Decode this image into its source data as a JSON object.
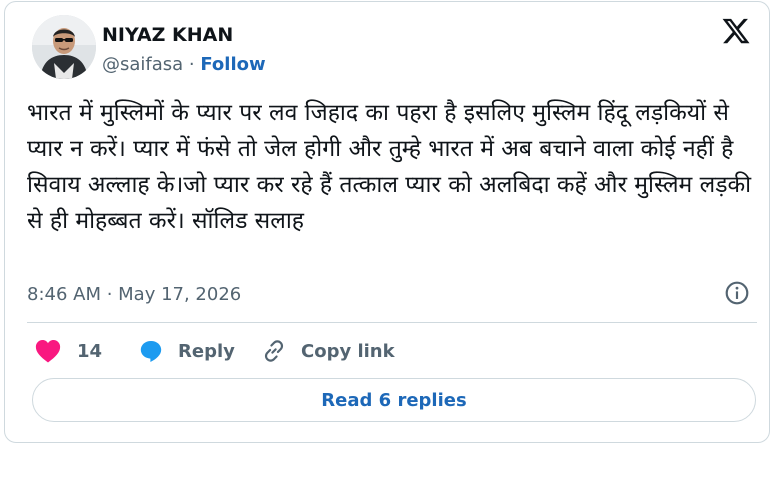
{
  "author": {
    "name": "NIYAZ KHAN",
    "handle": "@saifasa",
    "separator": " · ",
    "follow_label": "Follow"
  },
  "tweet": {
    "text": "भारत में मुस्लिमों के प्यार पर लव जिहाद का पहरा है इसलिए मुस्लिम हिंदू लड़कियों से प्यार न करें। प्यार में फंसे तो जेल होगी और तुम्हे भारत में अब बचाने वाला कोई नहीं है सिवाय अल्लाह के।जो प्यार कर रहे हैं तत्काल प्यार को अलबिदा कहें और मुस्लिम लड़की से ही मोहब्बत करें। सॉलिड सलाह",
    "timestamp": "8:46 AM · May 17, 2026"
  },
  "actions": {
    "like_count": "14",
    "reply_label": "Reply",
    "copy_link_label": "Copy link"
  },
  "read_replies_label": "Read 6 replies",
  "icons": {
    "logo": "x-logo-icon",
    "info": "info-icon",
    "like": "heart-icon",
    "reply": "reply-bubble-icon",
    "copy": "link-icon"
  },
  "colors": {
    "link": "#1d68b8",
    "heart": "#f91880",
    "reply_bubble": "#1d9bf0",
    "muted_text": "#536471",
    "border": "#cfd9de"
  }
}
